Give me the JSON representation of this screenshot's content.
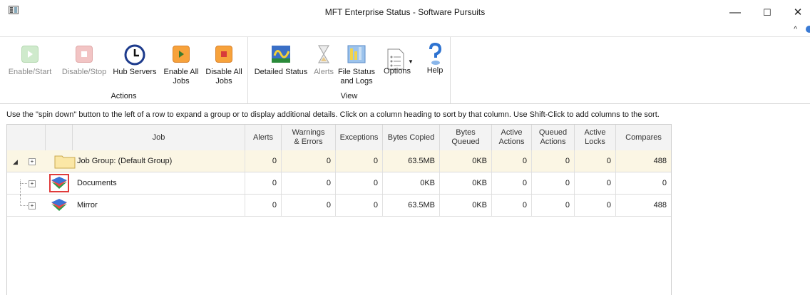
{
  "window": {
    "title": "MFT Enterprise Status - Software Pursuits",
    "minimize": "—",
    "maximize": "☐",
    "close": "✕",
    "collapse_ribbon": "^"
  },
  "ribbon": {
    "actions": {
      "label": "Actions",
      "buttons": [
        {
          "label": "Enable/Start",
          "icon": "play-icon",
          "enabled": false
        },
        {
          "label": "Disable/Stop",
          "icon": "stop-icon",
          "enabled": false
        },
        {
          "label": "Hub Servers",
          "icon": "clock-icon",
          "enabled": true
        },
        {
          "label": "Enable All Jobs",
          "icon": "play-all-icon",
          "enabled": true
        },
        {
          "label": "Disable All Jobs",
          "icon": "stop-all-icon",
          "enabled": true
        }
      ]
    },
    "view": {
      "label": "View",
      "buttons": [
        {
          "label": "Detailed Status",
          "icon": "detailed-status-icon",
          "enabled": true
        },
        {
          "label": "Alerts",
          "icon": "hourglass-icon",
          "enabled": false
        },
        {
          "label": "File Status and Logs",
          "icon": "file-status-icon",
          "enabled": true
        },
        {
          "label": "Options",
          "icon": "options-icon",
          "enabled": true
        },
        {
          "label": "Help",
          "icon": "help-icon",
          "enabled": true
        }
      ]
    }
  },
  "instruction": "Use the \"spin down\" button to the left of a row to expand a group or to display additional details. Click on a column heading to sort by that column. Use Shift-Click to add columns to the sort.",
  "table": {
    "columns": [
      "Job",
      "Alerts",
      "Warnings & Errors",
      "Exceptions",
      "Bytes Copied",
      "Bytes Queued",
      "Active Actions",
      "Queued Actions",
      "Active Locks",
      "Compares"
    ],
    "rows": [
      {
        "job": "Job Group: (Default Group)",
        "alerts": "0",
        "warnings": "0",
        "exceptions": "0",
        "bytes_copied": "63.5MB",
        "bytes_queued": "0KB",
        "active_actions": "0",
        "queued_actions": "0",
        "active_locks": "0",
        "compares": "488"
      },
      {
        "job": "Documents",
        "alerts": "0",
        "warnings": "0",
        "exceptions": "0",
        "bytes_copied": "0KB",
        "bytes_queued": "0KB",
        "active_actions": "0",
        "queued_actions": "0",
        "active_locks": "0",
        "compares": "0"
      },
      {
        "job": "Mirror",
        "alerts": "0",
        "warnings": "0",
        "exceptions": "0",
        "bytes_copied": "63.5MB",
        "bytes_queued": "0KB",
        "active_actions": "0",
        "queued_actions": "0",
        "active_locks": "0",
        "compares": "488"
      }
    ]
  }
}
